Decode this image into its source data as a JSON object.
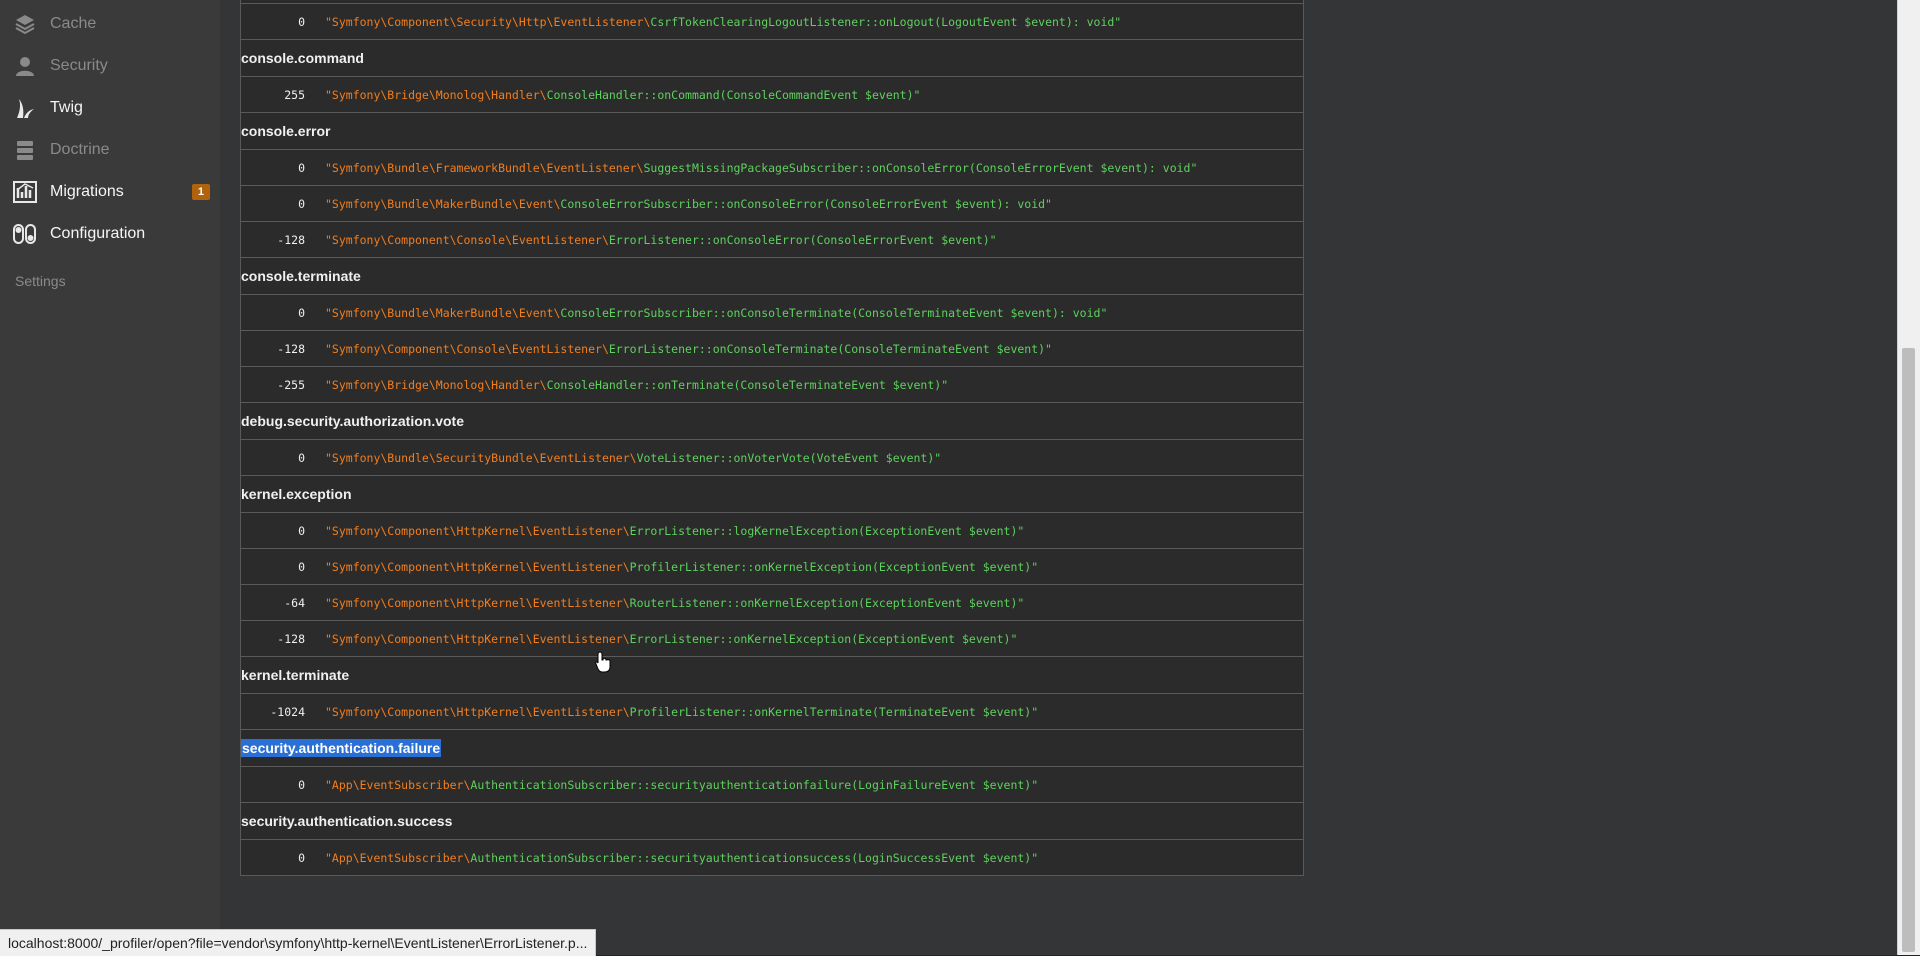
{
  "sidebar": {
    "items": [
      {
        "label": "Cache",
        "icon": "layers-icon",
        "disabled": true
      },
      {
        "label": "Security",
        "icon": "user-icon",
        "disabled": true
      },
      {
        "label": "Twig",
        "icon": "twig-icon",
        "disabled": false
      },
      {
        "label": "Doctrine",
        "icon": "database-icon",
        "disabled": true
      },
      {
        "label": "Migrations",
        "icon": "migrations-icon",
        "disabled": false,
        "badge": "1"
      },
      {
        "label": "Configuration",
        "icon": "toggles-icon",
        "disabled": false
      }
    ],
    "section_label": "Settings"
  },
  "events": [
    {
      "name": "",
      "listeners": [
        {
          "priority": "0",
          "ns": "\"Symfony\\Component\\Security\\Http\\EventListener\\",
          "cls": "CsrfTokenClearingLogoutListener::onLogout(LogoutEvent $event): void\""
        }
      ]
    },
    {
      "name": "console.command",
      "listeners": [
        {
          "priority": "255",
          "ns": "\"Symfony\\Bridge\\Monolog\\Handler\\",
          "cls": "ConsoleHandler::onCommand(ConsoleCommandEvent $event)\""
        }
      ]
    },
    {
      "name": "console.error",
      "listeners": [
        {
          "priority": "0",
          "ns": "\"Symfony\\Bundle\\FrameworkBundle\\EventListener\\",
          "cls": "SuggestMissingPackageSubscriber::onConsoleError(ConsoleErrorEvent $event): void\""
        },
        {
          "priority": "0",
          "ns": "\"Symfony\\Bundle\\MakerBundle\\Event\\",
          "cls": "ConsoleErrorSubscriber::onConsoleError(ConsoleErrorEvent $event): void\""
        },
        {
          "priority": "-128",
          "ns": "\"Symfony\\Component\\Console\\EventListener\\",
          "cls": "ErrorListener::onConsoleError(ConsoleErrorEvent $event)\""
        }
      ]
    },
    {
      "name": "console.terminate",
      "listeners": [
        {
          "priority": "0",
          "ns": "\"Symfony\\Bundle\\MakerBundle\\Event\\",
          "cls": "ConsoleErrorSubscriber::onConsoleTerminate(ConsoleTerminateEvent $event): void\""
        },
        {
          "priority": "-128",
          "ns": "\"Symfony\\Component\\Console\\EventListener\\",
          "cls": "ErrorListener::onConsoleTerminate(ConsoleTerminateEvent $event)\""
        },
        {
          "priority": "-255",
          "ns": "\"Symfony\\Bridge\\Monolog\\Handler\\",
          "cls": "ConsoleHandler::onTerminate(ConsoleTerminateEvent $event)\""
        }
      ]
    },
    {
      "name": "debug.security.authorization.vote",
      "listeners": [
        {
          "priority": "0",
          "ns": "\"Symfony\\Bundle\\SecurityBundle\\EventListener\\",
          "cls": "VoteListener::onVoterVote(VoteEvent $event)\""
        }
      ]
    },
    {
      "name": "kernel.exception",
      "listeners": [
        {
          "priority": "0",
          "ns": "\"Symfony\\Component\\HttpKernel\\EventListener\\",
          "cls": "ErrorListener::logKernelException(ExceptionEvent $event)\""
        },
        {
          "priority": "0",
          "ns": "\"Symfony\\Component\\HttpKernel\\EventListener\\",
          "cls": "ProfilerListener::onKernelException(ExceptionEvent $event)\""
        },
        {
          "priority": "-64",
          "ns": "\"Symfony\\Component\\HttpKernel\\EventListener\\",
          "cls": "RouterListener::onKernelException(ExceptionEvent $event)\""
        },
        {
          "priority": "-128",
          "ns": "\"Symfony\\Component\\HttpKernel\\EventListener\\",
          "cls": "ErrorListener::onKernelException(ExceptionEvent $event)\""
        }
      ]
    },
    {
      "name": "kernel.terminate",
      "listeners": [
        {
          "priority": "-1024",
          "ns": "\"Symfony\\Component\\HttpKernel\\EventListener\\",
          "cls": "ProfilerListener::onKernelTerminate(TerminateEvent $event)\""
        }
      ]
    },
    {
      "name": "security.authentication.failure",
      "selected": true,
      "listeners": [
        {
          "priority": "0",
          "ns": "\"App\\EventSubscriber\\",
          "cls": "AuthenticationSubscriber::securityauthenticationfailure(LoginFailureEvent $event)\""
        }
      ]
    },
    {
      "name": "security.authentication.success",
      "listeners": [
        {
          "priority": "0",
          "ns": "\"App\\EventSubscriber\\",
          "cls": "AuthenticationSubscriber::securityauthenticationsuccess(LoginSuccessEvent $event)\""
        }
      ]
    }
  ],
  "statusbar": {
    "url": "localhost:8000/_profiler/open?file=vendor\\symfony\\http-kernel\\EventListener\\ErrorListener.p..."
  },
  "colors": {
    "namespace": "#f27e1e",
    "class": "#5ed15e",
    "selection": "#2a6fd6",
    "badge": "#b0620c"
  }
}
